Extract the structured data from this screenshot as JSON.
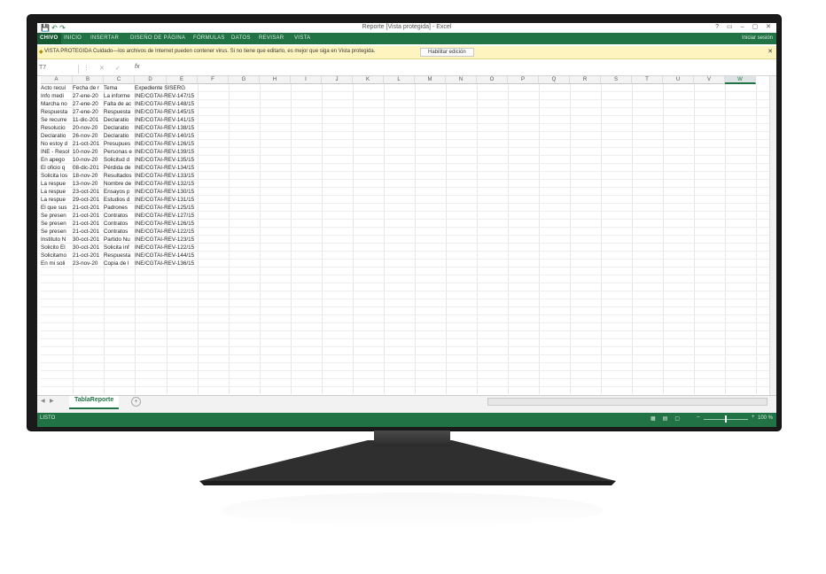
{
  "window": {
    "title": "Reporte  [Vista protegida] - Excel",
    "controls": [
      "?",
      "▭",
      "–",
      "▢",
      "✕"
    ],
    "sign_in": "Iniciar sesión"
  },
  "ribbon": {
    "tabs": [
      "CHIVO",
      "INICIO",
      "INSERTAR",
      "DISEÑO DE PÁGINA",
      "FÓRMULAS",
      "DATOS",
      "REVISAR",
      "VISTA"
    ]
  },
  "protected_view": {
    "message": "VISTA PROTEGIDA  Cuidado—los archivos de Internet pueden contener virus. Si no tiene que editarlo, es mejor que siga en Vista protegida.",
    "button": "Habilitar edición"
  },
  "formula_bar": {
    "name_box": "T7",
    "fx": "fx"
  },
  "columns": [
    "A",
    "B",
    "C",
    "D",
    "E",
    "F",
    "G",
    "H",
    "I",
    "J",
    "K",
    "L",
    "M",
    "N",
    "O",
    "P",
    "Q",
    "R",
    "S",
    "T",
    "U",
    "V",
    "W"
  ],
  "selected_column": "W",
  "rows": [
    [
      "Acto recui",
      "Fecha de r",
      "Tema",
      "Expediente SISERG"
    ],
    [
      "Info medi",
      "27-ene-20",
      "La informe",
      "INE/CGTAI-REV-147/15"
    ],
    [
      "Marcha no",
      "27-ene-20",
      "Falta de ac",
      "INE/CGTAI-REV-148/15"
    ],
    [
      "Respuesta",
      "27-ene-20",
      "Respuesta",
      "INE/CGTAI-REV-145/15"
    ],
    [
      "Se recurre",
      "11-dic-201",
      "Declaratio",
      "INE/CGTAI-REV-141/15"
    ],
    [
      "Resolucio",
      "20-nov-20",
      "Declaratio",
      "INE/CGTAI-REV-138/15"
    ],
    [
      "Declaratio",
      "26-nov-20",
      "Declaratio",
      "INE/CGTAI-REV-140/15"
    ],
    [
      "No estoy d",
      "21-oct-201",
      "Presupues",
      "INE/CGTAI-REV-126/15"
    ],
    [
      "INE - Resol",
      "10-nov-20",
      "Personas e",
      "INE/CGTAI-REV-139/15"
    ],
    [
      "En apego",
      "10-nov-20",
      "Solicitud d",
      "INE/CGTAI-REV-135/15"
    ],
    [
      "El oficio q",
      "08-dic-201",
      "Pérdida de",
      "INE/CGTAI-REV-134/15"
    ],
    [
      "Solicita los",
      "18-nov-20",
      "Resultados",
      "INE/CGTAI-REV-133/15"
    ],
    [
      "La respue",
      "13-nov-20",
      "Nombre de",
      "INE/CGTAI-REV-132/15"
    ],
    [
      "La respue",
      "23-oct-201",
      "Ensayos p",
      "INE/CGTAI-REV-130/15"
    ],
    [
      "La respue",
      "29-oct-201",
      "Estudios d",
      "INE/CGTAI-REV-131/15"
    ],
    [
      "El que sus",
      "21-oct-201",
      "Padrones",
      "INE/CGTAI-REV-125/15"
    ],
    [
      "Se presen",
      "21-oct-201",
      "Contratos",
      "INE/CGTAI-REV-127/15"
    ],
    [
      "Se presen",
      "21-oct-201",
      "Contratos",
      "INE/CGTAI-REV-126/15"
    ],
    [
      "Se presen",
      "21-oct-201",
      "Contratos",
      "INE/CGTAI-REV-122/15"
    ],
    [
      "Instituto N",
      "30-oct-201",
      "Partido Nu",
      "INE/CGTAI-REV-123/15"
    ],
    [
      "Solicito El",
      "30-oct-201",
      "Solicita inf",
      "INE/CGTAI-REV-122/15"
    ],
    [
      "Solicitamo",
      "21-oct-201",
      "Respuesta",
      "INE/CGTAI-REV-144/15"
    ],
    [
      "En mi soli",
      "23-nov-20",
      "Copia de l",
      "INE/CGTAI-REV-136/15"
    ]
  ],
  "sheet": {
    "name": "TablaReporte",
    "add": "+"
  },
  "status": {
    "ready": "LISTO",
    "zoom": "100 %",
    "zoom_minus": "–",
    "zoom_plus": "+"
  }
}
